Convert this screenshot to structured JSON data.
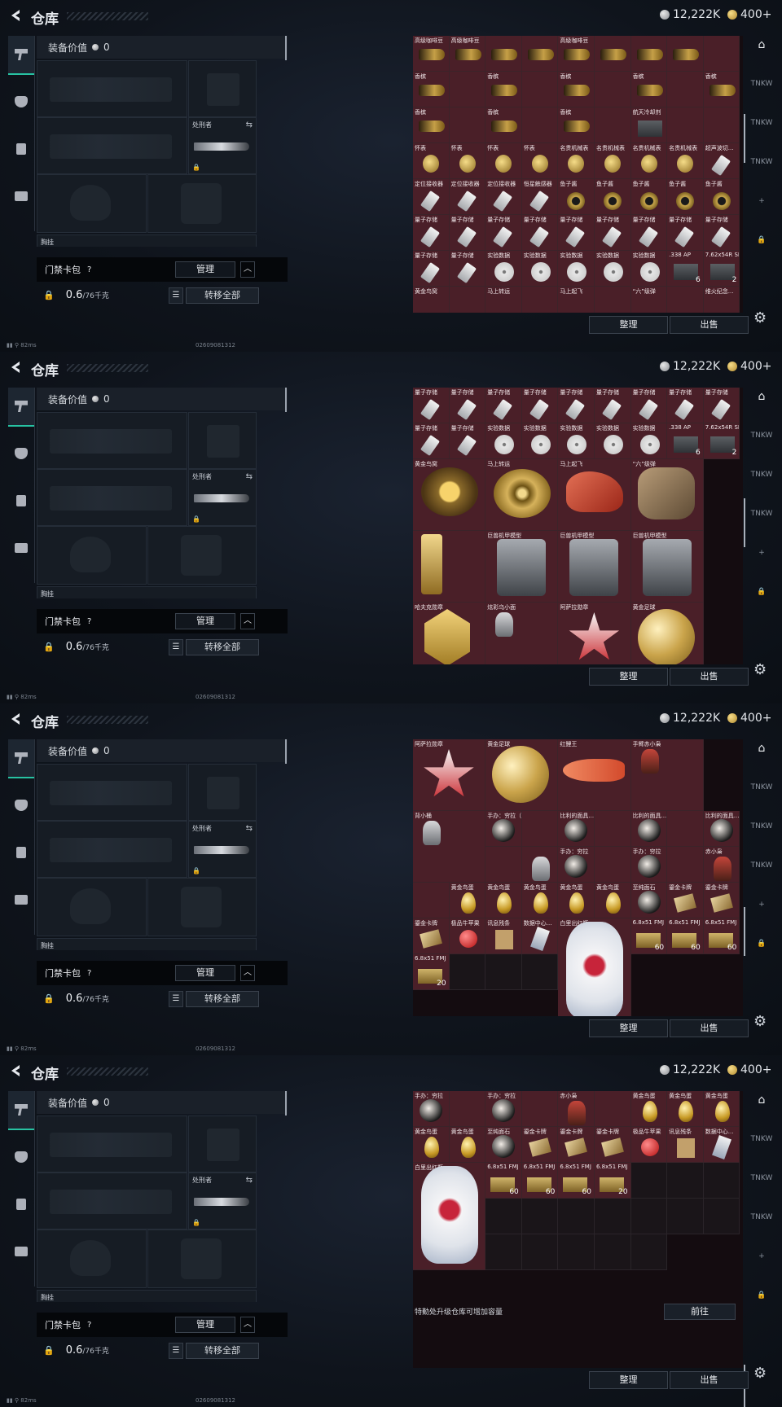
{
  "header": {
    "title": "仓库",
    "currency_silver": "12,222K",
    "currency_gold": "400+"
  },
  "loadout": {
    "value_label": "装备价值",
    "value": "0",
    "knife_label": "处刑者",
    "bag_name": "门禁卡包",
    "bag_help": "?",
    "manage_label": "管理",
    "weight": "0.6",
    "weight_cap": "/76千克",
    "transfer_all_label": "转移全部",
    "hidden_label": "胸挂"
  },
  "status": {
    "ping": "82ms",
    "session_id": "02609081312"
  },
  "actions": {
    "sort_label": "整理",
    "sell_label": "出售",
    "upgrade_text": "特勤处升级仓库可增加容量",
    "goto_label": "前往"
  },
  "frames": [
    {
      "cells": [
        {
          "n": "高级咖啡豆",
          "o": "bottle"
        },
        {
          "n": "高级咖啡豆",
          "o": "bottle"
        },
        {
          "n": "",
          "o": "bottle"
        },
        {
          "n": "",
          "o": "bottle"
        },
        {
          "n": "高级咖啡豆",
          "o": "bottle"
        },
        {
          "n": "",
          "o": "bottle"
        },
        {
          "n": "",
          "o": "bottle"
        },
        {
          "n": "",
          "o": "bottle"
        },
        {
          "n": "",
          "o": ""
        },
        {
          "n": "香槟",
          "o": "bottle"
        },
        {
          "n": "",
          "o": ""
        },
        {
          "n": "香槟",
          "o": "bottle"
        },
        {
          "n": "",
          "o": ""
        },
        {
          "n": "香槟",
          "o": "bottle"
        },
        {
          "n": "",
          "o": ""
        },
        {
          "n": "香槟",
          "o": "bottle"
        },
        {
          "n": "",
          "o": ""
        },
        {
          "n": "香槟",
          "o": "bottle"
        },
        {
          "n": "香槟",
          "o": "bottle"
        },
        {
          "n": "",
          "o": ""
        },
        {
          "n": "香槟",
          "o": "bottle"
        },
        {
          "n": "",
          "o": ""
        },
        {
          "n": "香槟",
          "o": "bottle"
        },
        {
          "n": "",
          "o": ""
        },
        {
          "n": "航天冷却剂",
          "o": "box"
        },
        {
          "n": "",
          "o": ""
        },
        {
          "n": "",
          "o": ""
        },
        {
          "n": "怀表",
          "o": "watch"
        },
        {
          "n": "怀表",
          "o": "watch"
        },
        {
          "n": "怀表",
          "o": "watch"
        },
        {
          "n": "怀表",
          "o": "watch"
        },
        {
          "n": "名贵机械表",
          "o": "watch"
        },
        {
          "n": "名贵机械表",
          "o": "watch"
        },
        {
          "n": "名贵机械表",
          "o": "watch"
        },
        {
          "n": "名贵机械表",
          "o": "watch"
        },
        {
          "n": "超声波切...",
          "o": "usb"
        },
        {
          "n": "定位接收器",
          "o": "usb"
        },
        {
          "n": "定位接收器",
          "o": "usb"
        },
        {
          "n": "定位接收器",
          "o": "usb"
        },
        {
          "n": "恒星触感器",
          "o": "usb"
        },
        {
          "n": "鱼子酱",
          "o": "ring"
        },
        {
          "n": "鱼子酱",
          "o": "ring"
        },
        {
          "n": "鱼子酱",
          "o": "ring"
        },
        {
          "n": "鱼子酱",
          "o": "ring"
        },
        {
          "n": "鱼子酱",
          "o": "ring"
        },
        {
          "n": "量子存储",
          "o": "usb"
        },
        {
          "n": "量子存储",
          "o": "usb"
        },
        {
          "n": "量子存储",
          "o": "usb"
        },
        {
          "n": "量子存储",
          "o": "usb"
        },
        {
          "n": "量子存储",
          "o": "usb"
        },
        {
          "n": "量子存储",
          "o": "usb"
        },
        {
          "n": "量子存储",
          "o": "usb"
        },
        {
          "n": "量子存储",
          "o": "usb"
        },
        {
          "n": "量子存储",
          "o": "usb"
        },
        {
          "n": "量子存储",
          "o": "usb"
        },
        {
          "n": "量子存储",
          "o": "usb"
        },
        {
          "n": "实验数据",
          "o": "disc"
        },
        {
          "n": "实验数据",
          "o": "disc"
        },
        {
          "n": "实验数据",
          "o": "disc"
        },
        {
          "n": "实验数据",
          "o": "disc"
        },
        {
          "n": "实验数据",
          "o": "disc"
        },
        {
          "n": ".338 AP",
          "o": "box",
          "c": "6"
        },
        {
          "n": "7.62x54R SNB",
          "o": "box",
          "c": "2"
        },
        {
          "n": "黄金鸟窝",
          "o": ""
        },
        {
          "n": "",
          "o": ""
        },
        {
          "n": "马上转运",
          "o": ""
        },
        {
          "n": "",
          "o": ""
        },
        {
          "n": "马上起飞",
          "o": ""
        },
        {
          "n": "",
          "o": ""
        },
        {
          "n": "“六”级弹",
          "o": ""
        },
        {
          "n": "",
          "o": ""
        },
        {
          "n": "维火纪念...",
          "o": ""
        }
      ]
    },
    {
      "cells": [
        {
          "n": "量子存储",
          "o": "usb"
        },
        {
          "n": "量子存储",
          "o": "usb"
        },
        {
          "n": "量子存储",
          "o": "usb"
        },
        {
          "n": "量子存储",
          "o": "usb"
        },
        {
          "n": "量子存储",
          "o": "usb"
        },
        {
          "n": "量子存储",
          "o": "usb"
        },
        {
          "n": "量子存储",
          "o": "usb"
        },
        {
          "n": "量子存储",
          "o": "usb"
        },
        {
          "n": "量子存储",
          "o": "usb"
        },
        {
          "n": "量子存储",
          "o": "usb"
        },
        {
          "n": "量子存储",
          "o": "usb"
        },
        {
          "n": "实验数据",
          "o": "disc"
        },
        {
          "n": "实验数据",
          "o": "disc"
        },
        {
          "n": "实验数据",
          "o": "disc"
        },
        {
          "n": "实验数据",
          "o": "disc"
        },
        {
          "n": "实验数据",
          "o": "disc"
        },
        {
          "n": ".338 AP",
          "o": "box",
          "c": "6"
        },
        {
          "n": "7.62x54R SNB",
          "o": "box",
          "c": "2"
        }
      ],
      "big": [
        {
          "n": "黄金鸟窝",
          "o": "big-nest"
        },
        {
          "n": "马上转运",
          "o": "big-wheel"
        },
        {
          "n": "马上起飞",
          "o": "big-horse"
        },
        {
          "n": "“六”级弹",
          "o": "big-hand"
        },
        {
          "n": "",
          "o": "big-trophy"
        },
        {
          "n": "巨兽机甲模型",
          "o": "big-mech"
        },
        {
          "n": "巨兽机甲模型",
          "o": "big-mech"
        },
        {
          "n": "巨兽机甲模型",
          "o": "big-mech"
        },
        {
          "n": "哈夫克勋章",
          "o": "big-badge"
        },
        {
          "n": "炫彩乌小面",
          "o": "figure"
        },
        {
          "n": "阿萨拉勋章",
          "o": "big-medal"
        },
        {
          "n": "黄金足球",
          "o": "big-ball"
        },
        {
          "n": "红鲤王",
          "o": "big-fish"
        },
        {
          "n": "手臂赤小枭",
          "o": "figure red"
        },
        {
          "n": "背小桶",
          "o": "figure"
        }
      ]
    },
    {
      "big": [
        {
          "n": "阿萨拉勋章",
          "o": "big-medal"
        },
        {
          "n": "黄金足球",
          "o": "big-ball"
        },
        {
          "n": "红鲤王",
          "o": "big-fish"
        },
        {
          "n": "手臂赤小枭",
          "o": "figure red"
        },
        {
          "n": "背小桶",
          "o": "figure"
        }
      ],
      "cells": [
        {
          "n": "手办：穷拉（暗夜）",
          "o": "head"
        },
        {
          "n": "",
          "o": ""
        },
        {
          "n": "比利的面具...",
          "o": "head"
        },
        {
          "n": "",
          "o": ""
        },
        {
          "n": "比利的面具...",
          "o": "head"
        },
        {
          "n": "",
          "o": ""
        },
        {
          "n": "比利的面具...",
          "o": "head"
        },
        {
          "n": "",
          "o": ""
        },
        {
          "n": "",
          "o": "figure"
        },
        {
          "n": "手办：穷拉",
          "o": "head"
        },
        {
          "n": "",
          "o": ""
        },
        {
          "n": "手办：穷拉",
          "o": "head"
        },
        {
          "n": "",
          "o": ""
        },
        {
          "n": "赤小枭",
          "o": "figure red"
        },
        {
          "n": "",
          "o": ""
        },
        {
          "n": "黄金鸟蛋",
          "o": "egg"
        },
        {
          "n": "黄金鸟蛋",
          "o": "egg"
        },
        {
          "n": "黄金鸟蛋",
          "o": "egg"
        },
        {
          "n": "黄金鸟蛋",
          "o": "egg"
        },
        {
          "n": "黄金鸟蛋",
          "o": "egg"
        },
        {
          "n": "至纯面石",
          "o": "head"
        },
        {
          "n": "鎏金卡牌",
          "o": "card"
        },
        {
          "n": "鎏金卡牌",
          "o": "card"
        },
        {
          "n": "鎏金卡牌",
          "o": "card"
        },
        {
          "n": "极品牛苹果",
          "o": "apple"
        },
        {
          "n": "讯息残条",
          "o": "paper"
        },
        {
          "n": "数据中心...",
          "o": "phone"
        },
        {
          "n": "白里出红瓶",
          "o": ""
        },
        {
          "n": "",
          "o": ""
        },
        {
          "n": "6.8x51 FMJ",
          "o": "ammo",
          "c": "60"
        },
        {
          "n": "6.8x51 FMJ",
          "o": "ammo",
          "c": "60"
        },
        {
          "n": "6.8x51 FMJ",
          "o": "ammo",
          "c": "60"
        },
        {
          "n": "6.8x51 FMJ",
          "o": "ammo",
          "c": "20"
        },
        {
          "n": "",
          "o": "empty"
        },
        {
          "n": "",
          "o": "empty"
        },
        {
          "n": "",
          "o": "empty"
        }
      ]
    },
    {
      "cells": [
        {
          "n": "手办：穷拉",
          "o": "head"
        },
        {
          "n": "",
          "o": ""
        },
        {
          "n": "手办：穷拉",
          "o": "head"
        },
        {
          "n": "",
          "o": ""
        },
        {
          "n": "赤小枭",
          "o": "figure red"
        },
        {
          "n": "",
          "o": ""
        },
        {
          "n": "黄金鸟蛋",
          "o": "egg"
        },
        {
          "n": "黄金鸟蛋",
          "o": "egg"
        },
        {
          "n": "黄金鸟蛋",
          "o": "egg"
        },
        {
          "n": "黄金鸟蛋",
          "o": "egg"
        },
        {
          "n": "黄金鸟蛋",
          "o": "egg"
        },
        {
          "n": "至纯面石",
          "o": "head"
        },
        {
          "n": "鎏金卡牌",
          "o": "card"
        },
        {
          "n": "鎏金卡牌",
          "o": "card"
        },
        {
          "n": "鎏金卡牌",
          "o": "card"
        },
        {
          "n": "极品牛苹果",
          "o": "apple"
        },
        {
          "n": "讯息残条",
          "o": "paper"
        },
        {
          "n": "数据中心...",
          "o": "phone"
        },
        {
          "n": "白里出红瓶",
          "o": ""
        },
        {
          "n": "",
          "o": ""
        },
        {
          "n": "6.8x51 FMJ",
          "o": "ammo",
          "c": "60"
        },
        {
          "n": "6.8x51 FMJ",
          "o": "ammo",
          "c": "60"
        },
        {
          "n": "6.8x51 FMJ",
          "o": "ammo",
          "c": "60"
        },
        {
          "n": "6.8x51 FMJ",
          "o": "ammo",
          "c": "20"
        },
        {
          "n": "",
          "o": "empty"
        },
        {
          "n": "",
          "o": "empty"
        },
        {
          "n": "",
          "o": "empty"
        }
      ]
    }
  ],
  "rightbar": [
    "⌂",
    "TNKW",
    "TNKW",
    "TNKW",
    "+",
    "🔒"
  ]
}
